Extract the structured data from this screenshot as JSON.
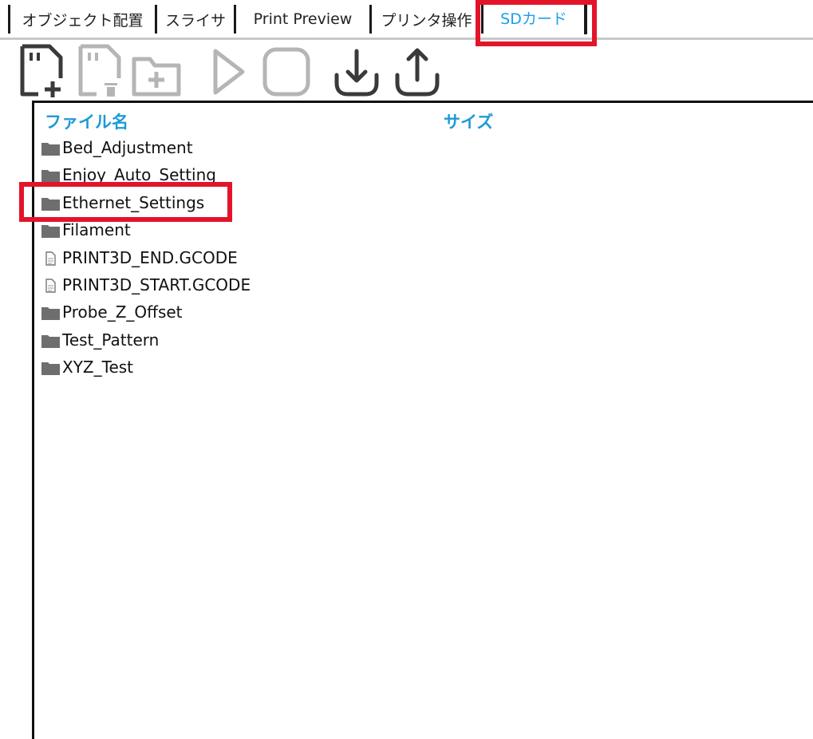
{
  "tabs": [
    {
      "label": "オブジェクト配置",
      "active": false
    },
    {
      "label": "スライサ",
      "active": false
    },
    {
      "label": "Print Preview",
      "active": false
    },
    {
      "label": "プリンタ操作",
      "active": false
    },
    {
      "label": "SDカード",
      "active": true
    }
  ],
  "toolbar": [
    {
      "icon": "new-file-icon",
      "enabled": true
    },
    {
      "icon": "delete-file-icon",
      "enabled": false
    },
    {
      "icon": "new-folder-icon",
      "enabled": false
    },
    {
      "icon": "play-icon",
      "enabled": false
    },
    {
      "icon": "stop-icon",
      "enabled": false
    },
    {
      "icon": "download-icon",
      "enabled": true
    },
    {
      "icon": "upload-icon",
      "enabled": true
    }
  ],
  "columns": {
    "name": "ファイル名",
    "size": "サイズ"
  },
  "files": [
    {
      "name": "Bed_Adjustment",
      "type": "folder"
    },
    {
      "name": "Enjoy_Auto_Setting",
      "type": "folder"
    },
    {
      "name": "Ethernet_Settings",
      "type": "folder"
    },
    {
      "name": "Filament",
      "type": "folder"
    },
    {
      "name": "PRINT3D_END.GCODE",
      "type": "file"
    },
    {
      "name": "PRINT3D_START.GCODE",
      "type": "file"
    },
    {
      "name": "Probe_Z_Offset",
      "type": "folder"
    },
    {
      "name": "Test_Pattern",
      "type": "folder"
    },
    {
      "name": "XYZ_Test",
      "type": "folder"
    }
  ],
  "colors": {
    "active_tab": "#1aa0ee",
    "header": "#1e9ad6",
    "highlight": "#e3142a",
    "icon_enabled": "#3a3a3a",
    "icon_disabled": "#b5b5b5",
    "folder": "#6e6e6e"
  }
}
